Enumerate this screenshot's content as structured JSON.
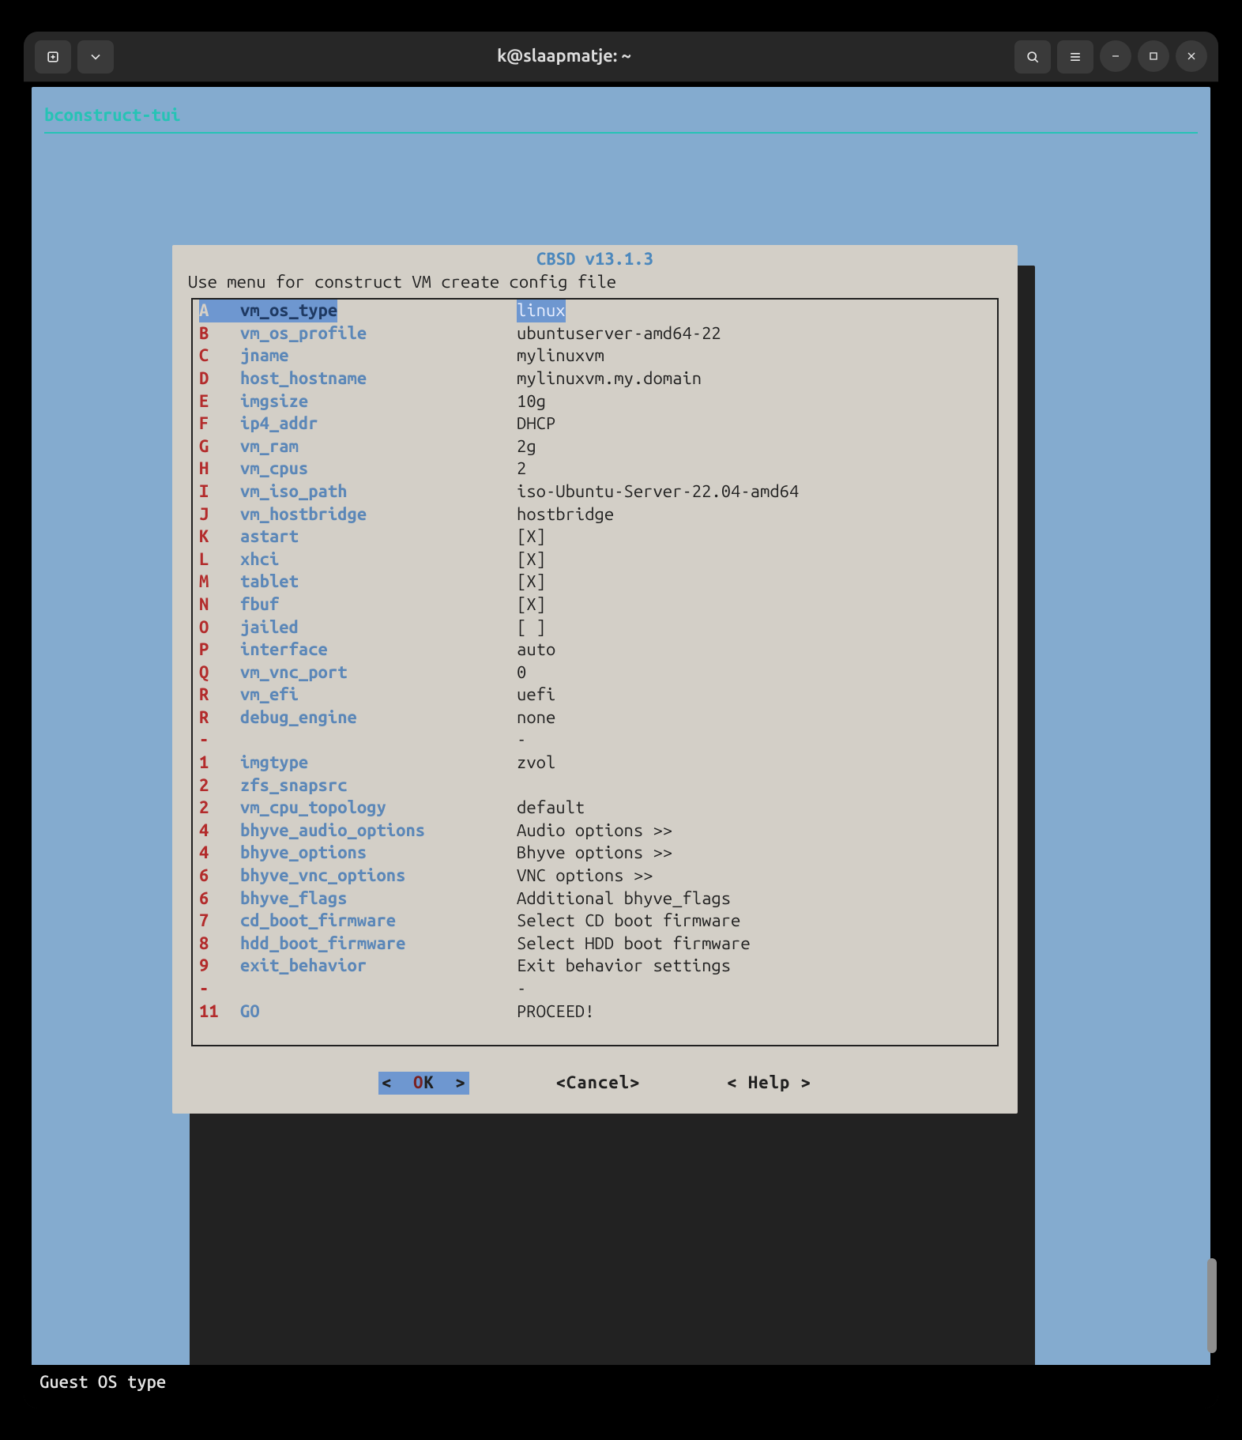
{
  "window": {
    "title": "k@slaapmatje: ~"
  },
  "tool_title": "bconstruct-tui",
  "dialog": {
    "title": "CBSD v13.1.3",
    "subtitle": "Use menu for construct VM create config file",
    "items": [
      {
        "key": "A",
        "field": "vm_os_type",
        "value": "linux",
        "selected": true
      },
      {
        "key": "B",
        "field": "vm_os_profile",
        "value": "ubuntuserver-amd64-22"
      },
      {
        "key": "C",
        "field": "jname",
        "value": "mylinuxvm"
      },
      {
        "key": "D",
        "field": "host_hostname",
        "value": "mylinuxvm.my.domain"
      },
      {
        "key": "E",
        "field": "imgsize",
        "value": "10g"
      },
      {
        "key": "F",
        "field": "ip4_addr",
        "value": "DHCP"
      },
      {
        "key": "G",
        "field": "vm_ram",
        "value": "2g"
      },
      {
        "key": "H",
        "field": "vm_cpus",
        "value": "2"
      },
      {
        "key": "I",
        "field": "vm_iso_path",
        "value": "iso-Ubuntu-Server-22.04-amd64"
      },
      {
        "key": "J",
        "field": "vm_hostbridge",
        "value": "hostbridge"
      },
      {
        "key": "K",
        "field": "astart",
        "value": "[X]"
      },
      {
        "key": "L",
        "field": "xhci",
        "value": "[X]"
      },
      {
        "key": "M",
        "field": "tablet",
        "value": "[X]"
      },
      {
        "key": "N",
        "field": "fbuf",
        "value": "[X]"
      },
      {
        "key": "O",
        "field": "jailed",
        "value": "[ ]"
      },
      {
        "key": "P",
        "field": "interface",
        "value": "auto"
      },
      {
        "key": "Q",
        "field": "vm_vnc_port",
        "value": "0"
      },
      {
        "key": "R",
        "field": "vm_efi",
        "value": "uefi"
      },
      {
        "key": "R",
        "field": "debug_engine",
        "value": "none"
      },
      {
        "key": "-",
        "field": "",
        "value": "-"
      },
      {
        "key": "1",
        "field": "imgtype",
        "value": "zvol"
      },
      {
        "key": "2",
        "field": "zfs_snapsrc",
        "value": ""
      },
      {
        "key": "2",
        "field": "vm_cpu_topology",
        "value": "default"
      },
      {
        "key": "4",
        "field": "bhyve_audio_options",
        "value": "Audio options >>"
      },
      {
        "key": "4",
        "field": "bhyve_options",
        "value": "Bhyve options >>"
      },
      {
        "key": "6",
        "field": "bhyve_vnc_options",
        "value": "VNC options >>"
      },
      {
        "key": "6",
        "field": "bhyve_flags",
        "value": "Additional bhyve_flags"
      },
      {
        "key": "7",
        "field": "cd_boot_firmware",
        "value": "Select CD boot firmware"
      },
      {
        "key": "8",
        "field": "hdd_boot_firmware",
        "value": "Select HDD boot firmware"
      },
      {
        "key": "9",
        "field": "exit_behavior",
        "value": "Exit behavior settings"
      },
      {
        "key": "-",
        "field": "",
        "value": "-"
      },
      {
        "key": "11",
        "field": "GO",
        "value": "PROCEED!",
        "blank_after": true
      }
    ],
    "buttons": {
      "ok": "<  OK  >",
      "cancel": "<Cancel>",
      "help": "< Help >"
    }
  },
  "status_line": "Guest OS type"
}
